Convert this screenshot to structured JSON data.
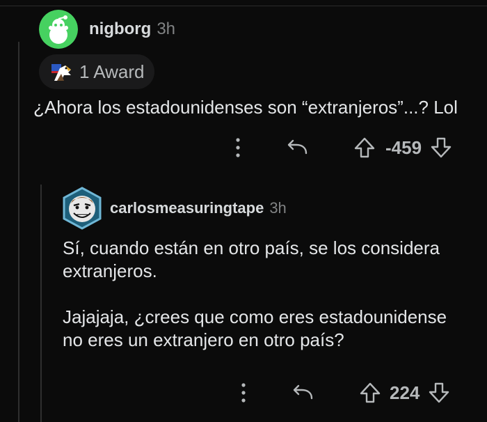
{
  "comment1": {
    "username": "nigborg",
    "time": "3h",
    "award_label": "1 Award",
    "body": "¿Ahora los estadounidenses son “extranjeros”...? Lol",
    "score": "-459"
  },
  "comment2": {
    "username": "carlosmeasuringtape",
    "time": "3h",
    "body_line1": "Sí, cuando están en otro país, se los considera",
    "body_line2": "extranjeros.",
    "body_line3": "Jajajaja, ¿crees que como eres estadounidense",
    "body_line4": "no eres un extranjero en otro país?",
    "score": "224"
  },
  "colors": {
    "background": "#0b0b0b",
    "avatar_green": "#46d160",
    "muted": "#818384"
  },
  "icons": [
    "reddit-snoo-icon",
    "eagle-award-icon",
    "more-options-icon",
    "reply-icon",
    "upvote-icon",
    "downvote-icon"
  ]
}
